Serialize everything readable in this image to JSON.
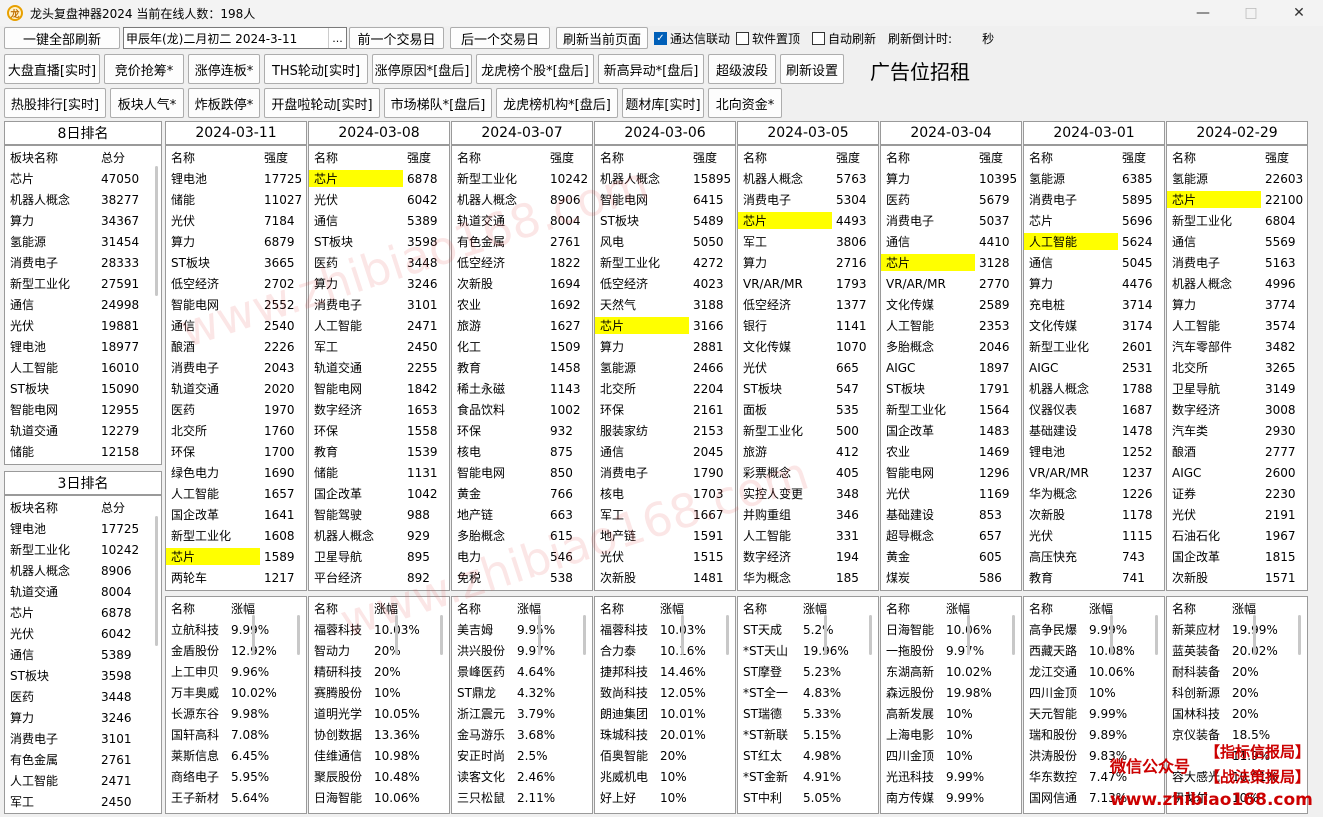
{
  "window": {
    "title": "龙头复盘神器2024 当前在线人数：198人",
    "icon": "app-logo-icon",
    "controls": [
      "minimize-icon",
      "maximize-icon",
      "close-icon"
    ]
  },
  "toolbar1": {
    "refresh_all": "一键全部刷新",
    "date_value": "甲辰年(龙)二月初二  2024-3-11",
    "date_btn": "...",
    "prev_day": "前一个交易日",
    "next_day": "后一个交易日",
    "refresh_page": "刷新当前页面",
    "tdx_link": "通达信联动",
    "tdx_link_checked": true,
    "topmost": "软件置顶",
    "topmost_checked": false,
    "auto_refresh": "自动刷新",
    "auto_refresh_checked": false,
    "countdown_label": "刷新倒计时:",
    "countdown_unit": "秒"
  },
  "toolbar2": [
    "大盘直播[实时]",
    "竞价抢筹*",
    "涨停连板*",
    "THS轮动[实时]",
    "涨停原因*[盘后]",
    "龙虎榜个股*[盘后]",
    "新高异动*[盘后]",
    "超级波段",
    "刷新设置"
  ],
  "toolbar3": [
    "热股排行[实时]",
    "板块人气*",
    "炸板跌停*",
    "开盘啦轮动[实时]",
    "市场梯队*[盘后]",
    "龙虎榜机构*[盘后]",
    "题材库[实时]",
    "北向资金*"
  ],
  "ad_text": "广告位招租",
  "left8": {
    "title": "8日排名",
    "headers": [
      "板块名称",
      "总分"
    ],
    "rows": [
      [
        "芯片",
        "47050"
      ],
      [
        "机器人概念",
        "38277"
      ],
      [
        "算力",
        "34367"
      ],
      [
        "氢能源",
        "31454"
      ],
      [
        "消费电子",
        "28333"
      ],
      [
        "新型工业化",
        "27591"
      ],
      [
        "通信",
        "24998"
      ],
      [
        "光伏",
        "19881"
      ],
      [
        "锂电池",
        "18977"
      ],
      [
        "人工智能",
        "16010"
      ],
      [
        "ST板块",
        "15090"
      ],
      [
        "智能电网",
        "12955"
      ],
      [
        "轨道交通",
        "12279"
      ],
      [
        "储能",
        "12158"
      ]
    ]
  },
  "left3": {
    "title": "3日排名",
    "headers": [
      "板块名称",
      "总分"
    ],
    "rows": [
      [
        "锂电池",
        "17725"
      ],
      [
        "新型工业化",
        "10242"
      ],
      [
        "机器人概念",
        "8906"
      ],
      [
        "轨道交通",
        "8004"
      ],
      [
        "芯片",
        "6878"
      ],
      [
        "光伏",
        "6042"
      ],
      [
        "通信",
        "5389"
      ],
      [
        "ST板块",
        "3598"
      ],
      [
        "医药",
        "3448"
      ],
      [
        "算力",
        "3246"
      ],
      [
        "消费电子",
        "3101"
      ],
      [
        "有色金属",
        "2761"
      ],
      [
        "人工智能",
        "2471"
      ],
      [
        "军工",
        "2450"
      ]
    ]
  },
  "days": [
    {
      "date": "2024-03-11",
      "hl": [
        18
      ],
      "sectors": [
        [
          "锂电池",
          "17725"
        ],
        [
          "储能",
          "11027"
        ],
        [
          "光伏",
          "7184"
        ],
        [
          "算力",
          "6879"
        ],
        [
          "ST板块",
          "3665"
        ],
        [
          "低空经济",
          "2702"
        ],
        [
          "智能电网",
          "2552"
        ],
        [
          "通信",
          "2540"
        ],
        [
          "酿酒",
          "2226"
        ],
        [
          "消费电子",
          "2043"
        ],
        [
          "轨道交通",
          "2020"
        ],
        [
          "医药",
          "1970"
        ],
        [
          "北交所",
          "1760"
        ],
        [
          "环保",
          "1700"
        ],
        [
          "绿色电力",
          "1690"
        ],
        [
          "人工智能",
          "1657"
        ],
        [
          "国企改革",
          "1641"
        ],
        [
          "新型工业化",
          "1608"
        ],
        [
          "芯片",
          "1589"
        ],
        [
          "两轮车",
          "1217"
        ]
      ],
      "stocks": [
        [
          "立航科技",
          "9.99%"
        ],
        [
          "金盾股份",
          "12.92%"
        ],
        [
          "上工申贝",
          "9.96%"
        ],
        [
          "万丰奥威",
          "10.02%"
        ],
        [
          "长源东谷",
          "9.98%"
        ],
        [
          "国轩高科",
          "7.08%"
        ],
        [
          "莱斯信息",
          "6.45%"
        ],
        [
          "商络电子",
          "5.95%"
        ],
        [
          "王子新材",
          "5.64%"
        ]
      ]
    },
    {
      "date": "2024-03-08",
      "hl": [
        0
      ],
      "sectors": [
        [
          "芯片",
          "6878"
        ],
        [
          "光伏",
          "6042"
        ],
        [
          "通信",
          "5389"
        ],
        [
          "ST板块",
          "3598"
        ],
        [
          "医药",
          "3448"
        ],
        [
          "算力",
          "3246"
        ],
        [
          "消费电子",
          "3101"
        ],
        [
          "人工智能",
          "2471"
        ],
        [
          "军工",
          "2450"
        ],
        [
          "轨道交通",
          "2255"
        ],
        [
          "智能电网",
          "1842"
        ],
        [
          "数字经济",
          "1653"
        ],
        [
          "环保",
          "1558"
        ],
        [
          "教育",
          "1539"
        ],
        [
          "储能",
          "1131"
        ],
        [
          "国企改革",
          "1042"
        ],
        [
          "智能驾驶",
          "988"
        ],
        [
          "机器人概念",
          "929"
        ],
        [
          "卫星导航",
          "895"
        ],
        [
          "平台经济",
          "892"
        ]
      ],
      "stocks": [
        [
          "福蓉科技",
          "10.03%"
        ],
        [
          "智动力",
          "20%"
        ],
        [
          "精研科技",
          "20%"
        ],
        [
          "赛腾股份",
          "10%"
        ],
        [
          "道明光学",
          "10.05%"
        ],
        [
          "协创数据",
          "13.36%"
        ],
        [
          "佳维通信",
          "10.98%"
        ],
        [
          "聚辰股份",
          "10.48%"
        ],
        [
          "日海智能",
          "10.06%"
        ]
      ]
    },
    {
      "date": "2024-03-07",
      "hl": [],
      "sectors": [
        [
          "新型工业化",
          "10242"
        ],
        [
          "机器人概念",
          "8906"
        ],
        [
          "轨道交通",
          "8004"
        ],
        [
          "有色金属",
          "2761"
        ],
        [
          "低空经济",
          "1822"
        ],
        [
          "次新股",
          "1694"
        ],
        [
          "农业",
          "1692"
        ],
        [
          "旅游",
          "1627"
        ],
        [
          "化工",
          "1509"
        ],
        [
          "教育",
          "1458"
        ],
        [
          "稀土永磁",
          "1143"
        ],
        [
          "食品饮料",
          "1002"
        ],
        [
          "环保",
          "932"
        ],
        [
          "核电",
          "875"
        ],
        [
          "智能电网",
          "850"
        ],
        [
          "黄金",
          "766"
        ],
        [
          "地产链",
          "663"
        ],
        [
          "多胎概念",
          "615"
        ],
        [
          "电力",
          "546"
        ],
        [
          "免税",
          "538"
        ]
      ],
      "stocks": [
        [
          "美吉姆",
          "9.95%"
        ],
        [
          "洪兴股份",
          "9.97%"
        ],
        [
          "景峰医药",
          "4.64%"
        ],
        [
          "ST鼎龙",
          "4.32%"
        ],
        [
          "浙江震元",
          "3.79%"
        ],
        [
          "金马游乐",
          "3.68%"
        ],
        [
          "安正时尚",
          "2.5%"
        ],
        [
          "读客文化",
          "2.46%"
        ],
        [
          "三只松鼠",
          "2.11%"
        ]
      ]
    },
    {
      "date": "2024-03-06",
      "hl": [
        7
      ],
      "sectors": [
        [
          "机器人概念",
          "15895"
        ],
        [
          "智能电网",
          "6415"
        ],
        [
          "ST板块",
          "5489"
        ],
        [
          "风电",
          "5050"
        ],
        [
          "新型工业化",
          "4272"
        ],
        [
          "低空经济",
          "4023"
        ],
        [
          "天然气",
          "3188"
        ],
        [
          "芯片",
          "3166"
        ],
        [
          "算力",
          "2881"
        ],
        [
          "氢能源",
          "2466"
        ],
        [
          "北交所",
          "2204"
        ],
        [
          "环保",
          "2161"
        ],
        [
          "服装家纺",
          "2153"
        ],
        [
          "通信",
          "2045"
        ],
        [
          "消费电子",
          "1790"
        ],
        [
          "核电",
          "1703"
        ],
        [
          "军工",
          "1667"
        ],
        [
          "地产链",
          "1591"
        ],
        [
          "光伏",
          "1515"
        ],
        [
          "次新股",
          "1481"
        ]
      ],
      "stocks": [
        [
          "福蓉科技",
          "10.03%"
        ],
        [
          "合力泰",
          "10.16%"
        ],
        [
          "捷邦科技",
          "14.46%"
        ],
        [
          "致尚科技",
          "12.05%"
        ],
        [
          "朗迪集团",
          "10.01%"
        ],
        [
          "珠城科技",
          "20.01%"
        ],
        [
          "佰奥智能",
          "20%"
        ],
        [
          "兆威机电",
          "10%"
        ],
        [
          "好上好",
          "10%"
        ]
      ]
    },
    {
      "date": "2024-03-05",
      "hl": [
        2
      ],
      "sectors": [
        [
          "机器人概念",
          "5763"
        ],
        [
          "消费电子",
          "5304"
        ],
        [
          "芯片",
          "4493"
        ],
        [
          "军工",
          "3806"
        ],
        [
          "算力",
          "2716"
        ],
        [
          "VR/AR/MR",
          "1793"
        ],
        [
          "低空经济",
          "1377"
        ],
        [
          "银行",
          "1141"
        ],
        [
          "文化传媒",
          "1070"
        ],
        [
          "光伏",
          "665"
        ],
        [
          "ST板块",
          "547"
        ],
        [
          "面板",
          "535"
        ],
        [
          "新型工业化",
          "500"
        ],
        [
          "旅游",
          "412"
        ],
        [
          "彩票概念",
          "405"
        ],
        [
          "实控人变更",
          "348"
        ],
        [
          "并购重组",
          "346"
        ],
        [
          "人工智能",
          "331"
        ],
        [
          "数字经济",
          "194"
        ],
        [
          "华为概念",
          "185"
        ]
      ],
      "stocks": [
        [
          "ST天成",
          "5.2%"
        ],
        [
          "*ST天山",
          "19.96%"
        ],
        [
          "ST摩登",
          "5.23%"
        ],
        [
          "*ST全一",
          "4.83%"
        ],
        [
          "ST瑞德",
          "5.33%"
        ],
        [
          "*ST新联",
          "5.15%"
        ],
        [
          "ST红太",
          "4.98%"
        ],
        [
          "*ST金新",
          "4.91%"
        ],
        [
          "ST中利",
          "5.05%"
        ]
      ]
    },
    {
      "date": "2024-03-04",
      "hl": [
        4
      ],
      "sectors": [
        [
          "算力",
          "10395"
        ],
        [
          "医药",
          "5679"
        ],
        [
          "消费电子",
          "5037"
        ],
        [
          "通信",
          "4410"
        ],
        [
          "芯片",
          "3128"
        ],
        [
          "VR/AR/MR",
          "2770"
        ],
        [
          "文化传媒",
          "2589"
        ],
        [
          "人工智能",
          "2353"
        ],
        [
          "多胎概念",
          "2046"
        ],
        [
          "AIGC",
          "1897"
        ],
        [
          "ST板块",
          "1791"
        ],
        [
          "新型工业化",
          "1564"
        ],
        [
          "国企改革",
          "1483"
        ],
        [
          "农业",
          "1469"
        ],
        [
          "智能电网",
          "1296"
        ],
        [
          "光伏",
          "1169"
        ],
        [
          "基础建设",
          "853"
        ],
        [
          "超导概念",
          "657"
        ],
        [
          "黄金",
          "605"
        ],
        [
          "煤炭",
          "586"
        ]
      ],
      "stocks": [
        [
          "日海智能",
          "10.06%"
        ],
        [
          "一拖股份",
          "9.97%"
        ],
        [
          "东湖高新",
          "10.02%"
        ],
        [
          "森远股份",
          "19.98%"
        ],
        [
          "高新发展",
          "10%"
        ],
        [
          "上海电影",
          "10%"
        ],
        [
          "四川金顶",
          "10%"
        ],
        [
          "光迅科技",
          "9.99%"
        ],
        [
          "南方传媒",
          "9.99%"
        ]
      ]
    },
    {
      "date": "2024-03-01",
      "hl": [
        3
      ],
      "sectors": [
        [
          "氢能源",
          "6385"
        ],
        [
          "消费电子",
          "5895"
        ],
        [
          "芯片",
          "5696"
        ],
        [
          "人工智能",
          "5624"
        ],
        [
          "通信",
          "5045"
        ],
        [
          "算力",
          "4476"
        ],
        [
          "充电桩",
          "3714"
        ],
        [
          "文化传媒",
          "3174"
        ],
        [
          "新型工业化",
          "2601"
        ],
        [
          "AIGC",
          "2531"
        ],
        [
          "机器人概念",
          "1788"
        ],
        [
          "仪器仪表",
          "1687"
        ],
        [
          "基础建设",
          "1478"
        ],
        [
          "锂电池",
          "1252"
        ],
        [
          "VR/AR/MR",
          "1237"
        ],
        [
          "华为概念",
          "1226"
        ],
        [
          "次新股",
          "1178"
        ],
        [
          "光伏",
          "1115"
        ],
        [
          "高压快充",
          "743"
        ],
        [
          "教育",
          "741"
        ]
      ],
      "stocks": [
        [
          "高争民爆",
          "9.99%"
        ],
        [
          "西藏天路",
          "10.08%"
        ],
        [
          "龙江交通",
          "10.06%"
        ],
        [
          "四川金顶",
          "10%"
        ],
        [
          "天元智能",
          "9.99%"
        ],
        [
          "瑞和股份",
          "9.89%"
        ],
        [
          "洪涛股份",
          "9.83%"
        ],
        [
          "华东数控",
          "7.47%"
        ],
        [
          "国网信通",
          "7.13%"
        ]
      ]
    },
    {
      "date": "2024-02-29",
      "hl": [
        1
      ],
      "sectors": [
        [
          "氢能源",
          "22603"
        ],
        [
          "芯片",
          "22100"
        ],
        [
          "新型工业化",
          "6804"
        ],
        [
          "通信",
          "5569"
        ],
        [
          "消费电子",
          "5163"
        ],
        [
          "机器人概念",
          "4996"
        ],
        [
          "算力",
          "3774"
        ],
        [
          "人工智能",
          "3574"
        ],
        [
          "汽车零部件",
          "3482"
        ],
        [
          "北交所",
          "3265"
        ],
        [
          "卫星导航",
          "3149"
        ],
        [
          "数字经济",
          "3008"
        ],
        [
          "汽车类",
          "2930"
        ],
        [
          "酿酒",
          "2777"
        ],
        [
          "AIGC",
          "2600"
        ],
        [
          "证券",
          "2230"
        ],
        [
          "光伏",
          "2191"
        ],
        [
          "石油石化",
          "1967"
        ],
        [
          "国企改革",
          "1815"
        ],
        [
          "次新股",
          "1571"
        ]
      ],
      "stocks": [
        [
          "新莱应材",
          "19.99%"
        ],
        [
          "蓝英装备",
          "20.02%"
        ],
        [
          "耐科装备",
          "20%"
        ],
        [
          "科创新源",
          "20%"
        ],
        [
          "国林科技",
          "20%"
        ],
        [
          "京仪装备",
          "18.5%"
        ],
        [
          "",
          "11.9%"
        ],
        [
          "容大感光",
          "10.01%"
        ],
        [
          "伊戈尔",
          "10%"
        ]
      ]
    }
  ],
  "grid_headers": {
    "sector": "名称",
    "strength": "强度",
    "stock": "名称",
    "change": "涨幅"
  },
  "overlay": {
    "wechat": "微信公众号",
    "brand1": "【指标信报局】",
    "brand2": "【战法策报局】",
    "url": "www.zhibiao168.com",
    "wm1": "www.zhibiao168.com",
    "wm2": "www.zhibiao168.com"
  }
}
